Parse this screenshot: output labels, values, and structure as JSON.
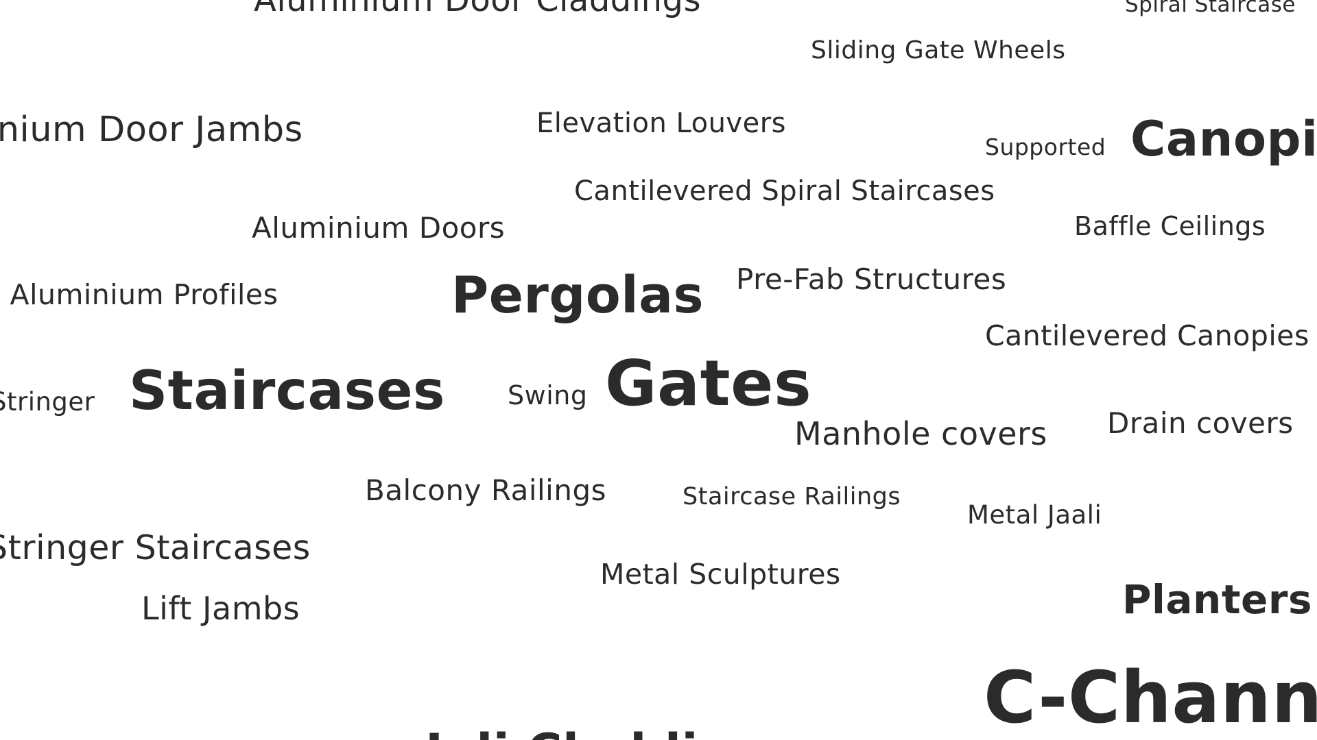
{
  "cloud": {
    "words": [
      "Aluminium Door Claddings",
      "Spiral Staircase",
      "Sliding Gate Wheels",
      "Aluminium Door Jambs",
      "Elevation Louvers",
      "Supported",
      "Canopies",
      "Cantilevered Spiral Staircases",
      "Aluminium Doors",
      "Baffle Ceilings",
      "Simple Aluminium Profiles",
      "Pergolas",
      "Pre-Fab Structures",
      "Cantilevered Canopies",
      "Stringer",
      "Staircases",
      "Swing",
      "Gates",
      "Manhole covers",
      "Drain covers",
      "Balcony Railings",
      "Staircase Railings",
      "Metal Jaali",
      "Stringer Staircases",
      "Metal Sculptures",
      "Planters",
      "Lift Jambs",
      "C-Channels",
      "Jali Cladding"
    ]
  }
}
